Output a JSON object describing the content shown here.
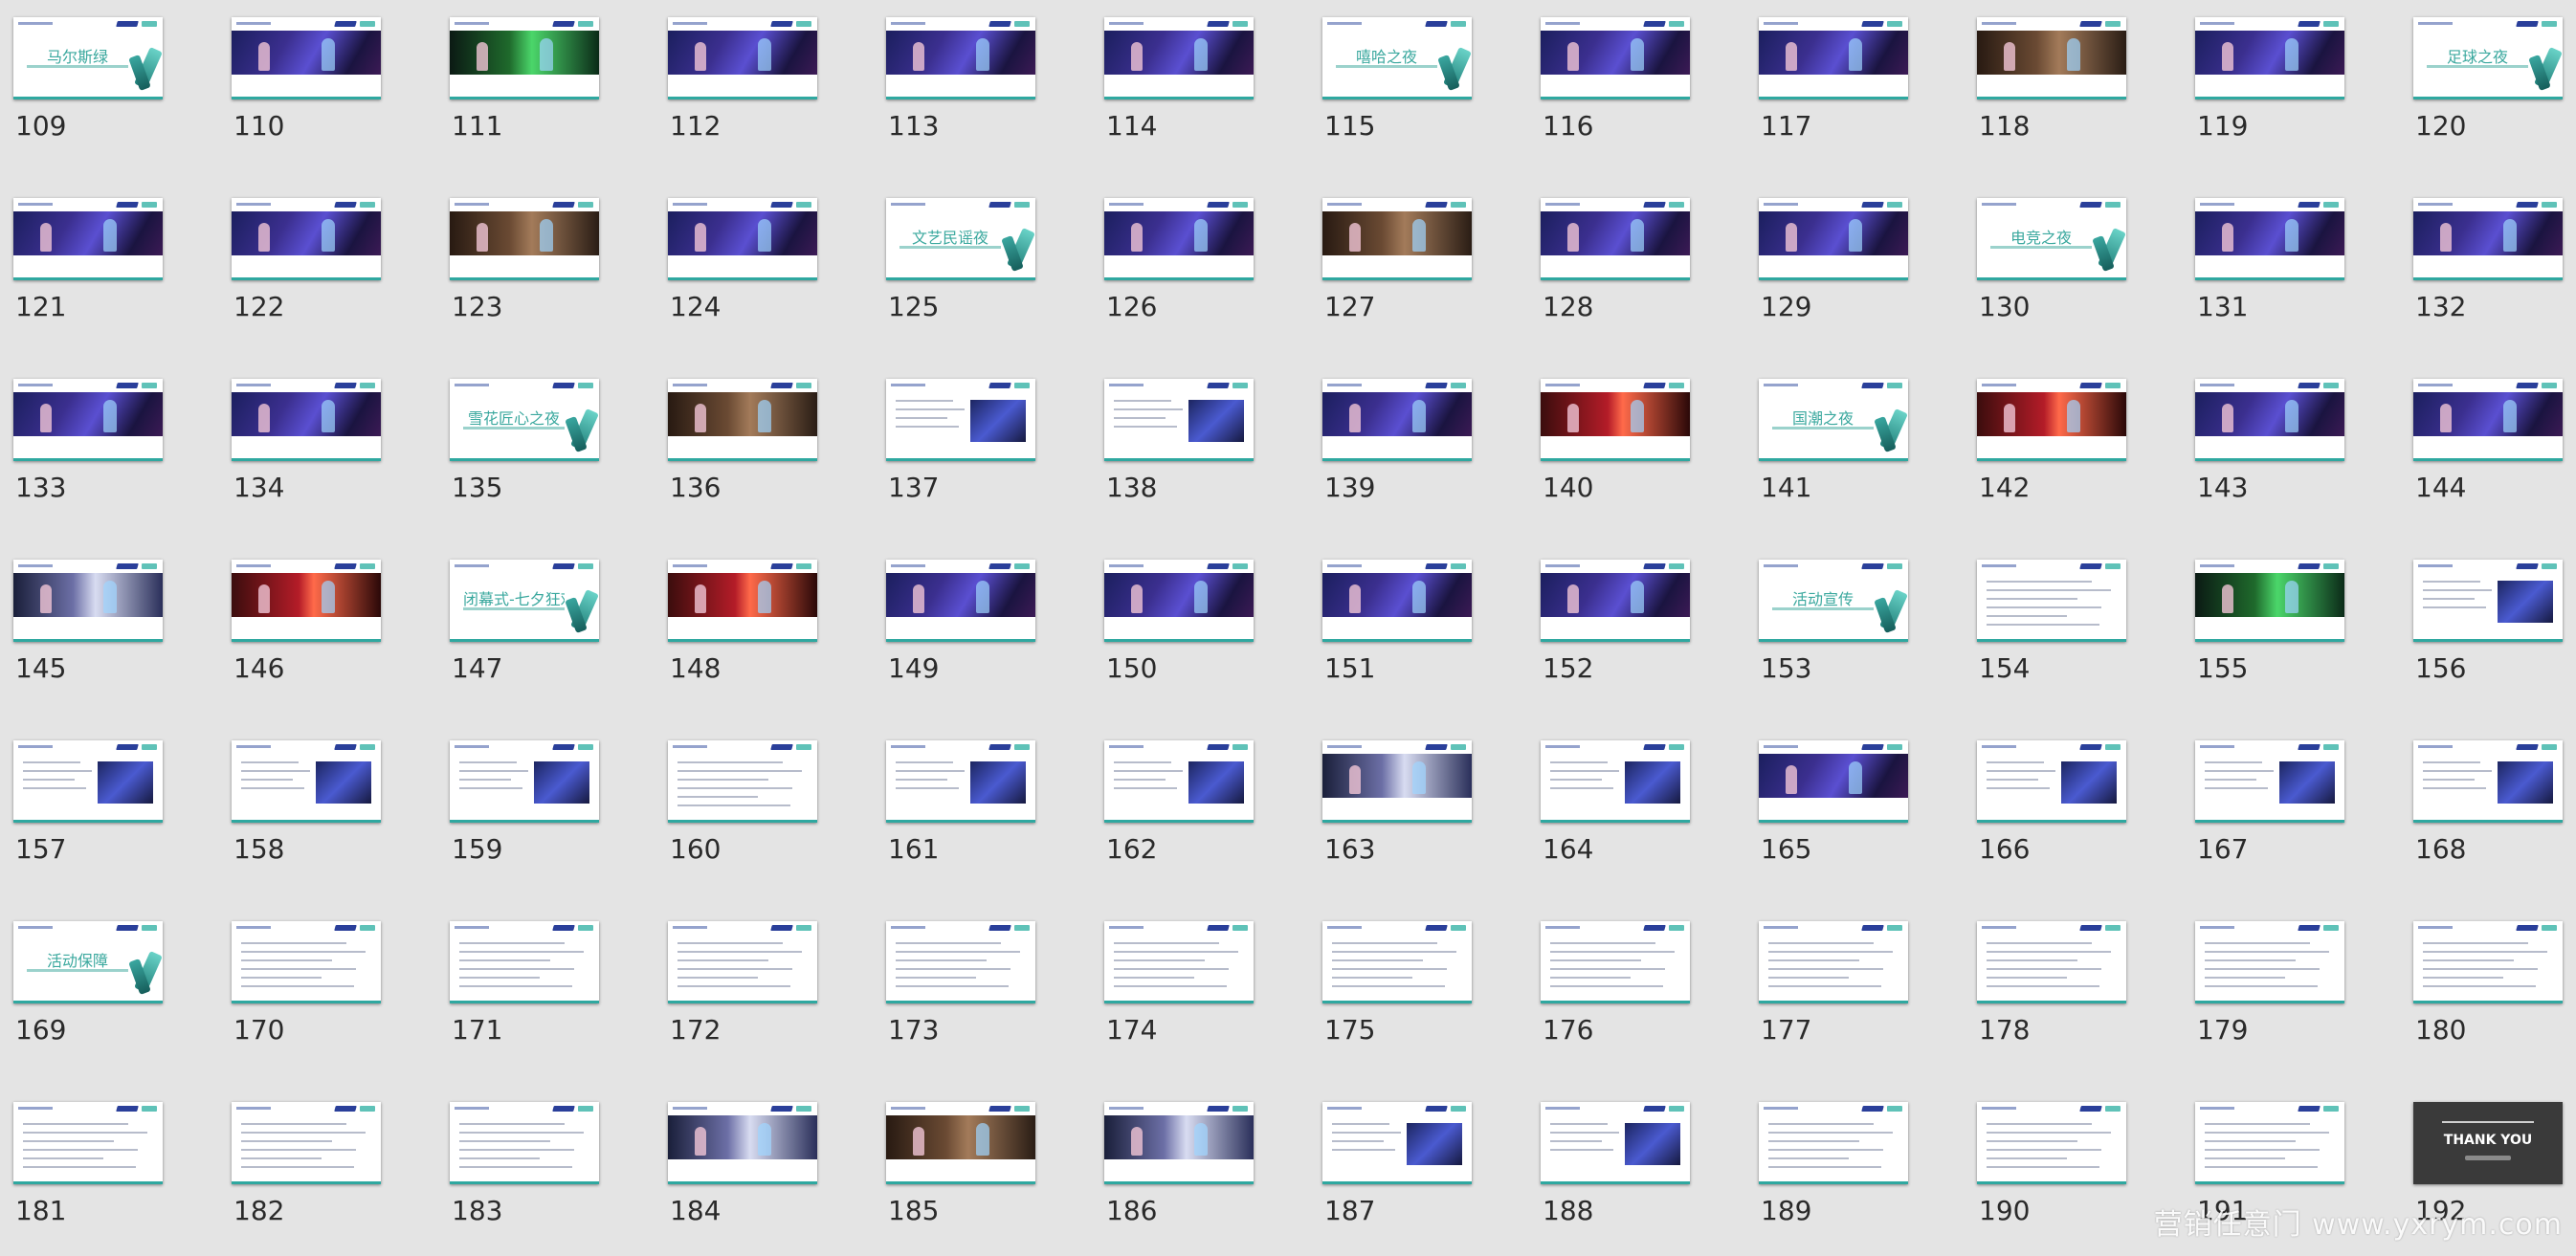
{
  "slides": [
    {
      "n": "109",
      "kind": "title",
      "title": "马尔斯绿"
    },
    {
      "n": "110",
      "kind": "photo"
    },
    {
      "n": "111",
      "kind": "photo",
      "v": "v1"
    },
    {
      "n": "112",
      "kind": "photo"
    },
    {
      "n": "113",
      "kind": "photo"
    },
    {
      "n": "114",
      "kind": "photo"
    },
    {
      "n": "115",
      "kind": "title",
      "title": "嘻哈之夜"
    },
    {
      "n": "116",
      "kind": "photo"
    },
    {
      "n": "117",
      "kind": "photo"
    },
    {
      "n": "118",
      "kind": "photo",
      "v": "v4"
    },
    {
      "n": "119",
      "kind": "photo"
    },
    {
      "n": "120",
      "kind": "title",
      "title": "足球之夜"
    },
    {
      "n": "121",
      "kind": "photo"
    },
    {
      "n": "122",
      "kind": "photo"
    },
    {
      "n": "123",
      "kind": "photo",
      "v": "v4"
    },
    {
      "n": "124",
      "kind": "photo"
    },
    {
      "n": "125",
      "kind": "title",
      "title": "文艺民谣夜"
    },
    {
      "n": "126",
      "kind": "photo"
    },
    {
      "n": "127",
      "kind": "photo",
      "v": "v4"
    },
    {
      "n": "128",
      "kind": "photo"
    },
    {
      "n": "129",
      "kind": "photo"
    },
    {
      "n": "130",
      "kind": "title",
      "title": "电竞之夜"
    },
    {
      "n": "131",
      "kind": "photo"
    },
    {
      "n": "132",
      "kind": "photo"
    },
    {
      "n": "133",
      "kind": "photo"
    },
    {
      "n": "134",
      "kind": "photo"
    },
    {
      "n": "135",
      "kind": "title",
      "title": "雪花匠心之夜"
    },
    {
      "n": "136",
      "kind": "photo",
      "v": "v4"
    },
    {
      "n": "137",
      "kind": "mixed"
    },
    {
      "n": "138",
      "kind": "mixed"
    },
    {
      "n": "139",
      "kind": "photo"
    },
    {
      "n": "140",
      "kind": "photo",
      "v": "v2"
    },
    {
      "n": "141",
      "kind": "title",
      "title": "国潮之夜"
    },
    {
      "n": "142",
      "kind": "photo",
      "v": "v2"
    },
    {
      "n": "143",
      "kind": "photo"
    },
    {
      "n": "144",
      "kind": "photo"
    },
    {
      "n": "145",
      "kind": "photo",
      "v": "v3"
    },
    {
      "n": "146",
      "kind": "photo",
      "v": "v2"
    },
    {
      "n": "147",
      "kind": "title",
      "title": "闭幕式-七夕狂欢夜"
    },
    {
      "n": "148",
      "kind": "photo",
      "v": "v2"
    },
    {
      "n": "149",
      "kind": "photo"
    },
    {
      "n": "150",
      "kind": "photo"
    },
    {
      "n": "151",
      "kind": "photo"
    },
    {
      "n": "152",
      "kind": "photo"
    },
    {
      "n": "153",
      "kind": "title",
      "title": "活动宣传"
    },
    {
      "n": "154",
      "kind": "text"
    },
    {
      "n": "155",
      "kind": "photo",
      "v": "v1"
    },
    {
      "n": "156",
      "kind": "mixed"
    },
    {
      "n": "157",
      "kind": "mixed"
    },
    {
      "n": "158",
      "kind": "mixed"
    },
    {
      "n": "159",
      "kind": "mixed"
    },
    {
      "n": "160",
      "kind": "text"
    },
    {
      "n": "161",
      "kind": "mixed"
    },
    {
      "n": "162",
      "kind": "mixed"
    },
    {
      "n": "163",
      "kind": "photo",
      "v": "v3"
    },
    {
      "n": "164",
      "kind": "mixed"
    },
    {
      "n": "165",
      "kind": "photo"
    },
    {
      "n": "166",
      "kind": "mixed"
    },
    {
      "n": "167",
      "kind": "mixed"
    },
    {
      "n": "168",
      "kind": "mixed"
    },
    {
      "n": "169",
      "kind": "title",
      "title": "活动保障"
    },
    {
      "n": "170",
      "kind": "text"
    },
    {
      "n": "171",
      "kind": "text"
    },
    {
      "n": "172",
      "kind": "text"
    },
    {
      "n": "173",
      "kind": "text"
    },
    {
      "n": "174",
      "kind": "text"
    },
    {
      "n": "175",
      "kind": "text"
    },
    {
      "n": "176",
      "kind": "text"
    },
    {
      "n": "177",
      "kind": "text"
    },
    {
      "n": "178",
      "kind": "text"
    },
    {
      "n": "179",
      "kind": "text"
    },
    {
      "n": "180",
      "kind": "text"
    },
    {
      "n": "181",
      "kind": "text"
    },
    {
      "n": "182",
      "kind": "text"
    },
    {
      "n": "183",
      "kind": "text"
    },
    {
      "n": "184",
      "kind": "photo",
      "v": "v3"
    },
    {
      "n": "185",
      "kind": "photo",
      "v": "v4"
    },
    {
      "n": "186",
      "kind": "photo",
      "v": "v3"
    },
    {
      "n": "187",
      "kind": "mixed"
    },
    {
      "n": "188",
      "kind": "mixed"
    },
    {
      "n": "189",
      "kind": "text"
    },
    {
      "n": "190",
      "kind": "text"
    },
    {
      "n": "191",
      "kind": "text"
    },
    {
      "n": "192",
      "kind": "dark",
      "title": "THANK YOU"
    }
  ],
  "watermark": "营销任意门 www.yxrym.com",
  "colors": {
    "background": "#e4e4e4",
    "teal": "#3aa89e",
    "navy": "#2a3f9a",
    "number": "#2a2a2a"
  }
}
